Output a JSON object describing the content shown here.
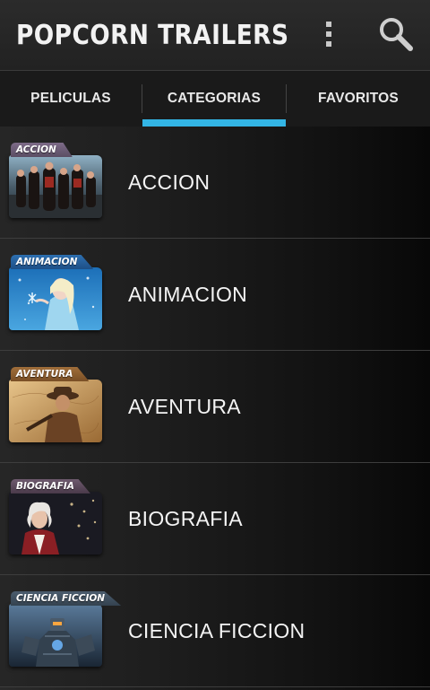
{
  "app": {
    "title": "POPCORN TRAILERS"
  },
  "toolbar": {
    "overflow_icon": "more-vertical-icon",
    "search_icon": "search-icon"
  },
  "tabs": [
    {
      "label": "PELICULAS",
      "selected": false
    },
    {
      "label": "CATEGORIAS",
      "selected": true
    },
    {
      "label": "FAVORITOS",
      "selected": false
    }
  ],
  "colors": {
    "accent": "#33b5e5",
    "background": "#1e1e1e",
    "text": "#f4f4f4"
  },
  "categories": [
    {
      "label": "ACCION",
      "folder_label": "ACCION"
    },
    {
      "label": "ANIMACION",
      "folder_label": "ANIMACION"
    },
    {
      "label": "AVENTURA",
      "folder_label": "AVENTURA"
    },
    {
      "label": "BIOGRAFIA",
      "folder_label": "BIOGRAFIA"
    },
    {
      "label": "CIENCIA FICCION",
      "folder_label": "CIENCIA FICCION"
    }
  ]
}
